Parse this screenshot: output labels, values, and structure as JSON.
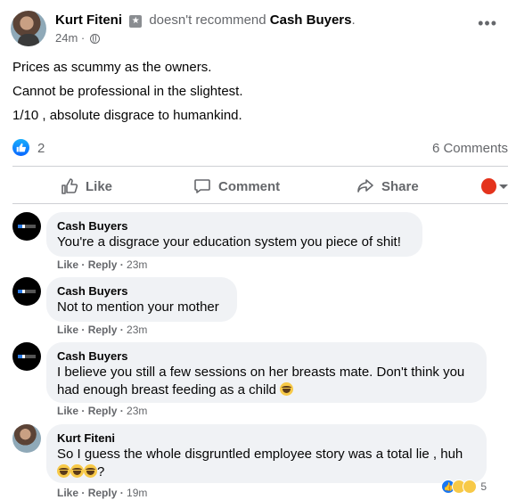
{
  "post": {
    "author": "Kurt Fiteni",
    "verb": "doesn't recommend",
    "page": "Cash Buyers",
    "period": ".",
    "time": "24m",
    "dot": "·",
    "lines": [
      "Prices as scummy as the owners.",
      "Cannot be professional in the slightest.",
      "1/10 , absolute disgrace to humankind."
    ],
    "reaction_count": "2",
    "comments_count": "6 Comments"
  },
  "actions": {
    "like": "Like",
    "comment": "Comment",
    "share": "Share"
  },
  "comments": [
    {
      "author": "Cash Buyers",
      "text": "You're a disgrace your education system you piece of shit!",
      "like": "Like",
      "reply": "Reply",
      "time": "23m"
    },
    {
      "author": "Cash Buyers",
      "text": "Not to mention your mother",
      "like": "Like",
      "reply": "Reply",
      "time": "23m"
    },
    {
      "author": "Cash Buyers",
      "text_line1": "I believe you still a few sessions on her breasts mate. Don't think you",
      "text_line2": "had enough breast feeding as a child",
      "like": "Like",
      "reply": "Reply",
      "time": "23m"
    },
    {
      "author": "Kurt Fiteni",
      "text_line1": "So I guess the whole disgruntled employee story was a total lie , huh",
      "text_line2_suffix": "?",
      "like": "Like",
      "reply": "Reply",
      "time": "19m",
      "reaction_count": "5"
    }
  ],
  "icons": {
    "more": "more-options-icon",
    "globe": "globe-icon",
    "like_badge": "like-badge-icon",
    "thumb": "thumbs-up-icon",
    "comment": "comment-icon",
    "share": "share-arrow-icon"
  },
  "colors": {
    "accent": "#1877f2",
    "secondary_text": "#65676b",
    "bubble": "#f0f2f5"
  }
}
